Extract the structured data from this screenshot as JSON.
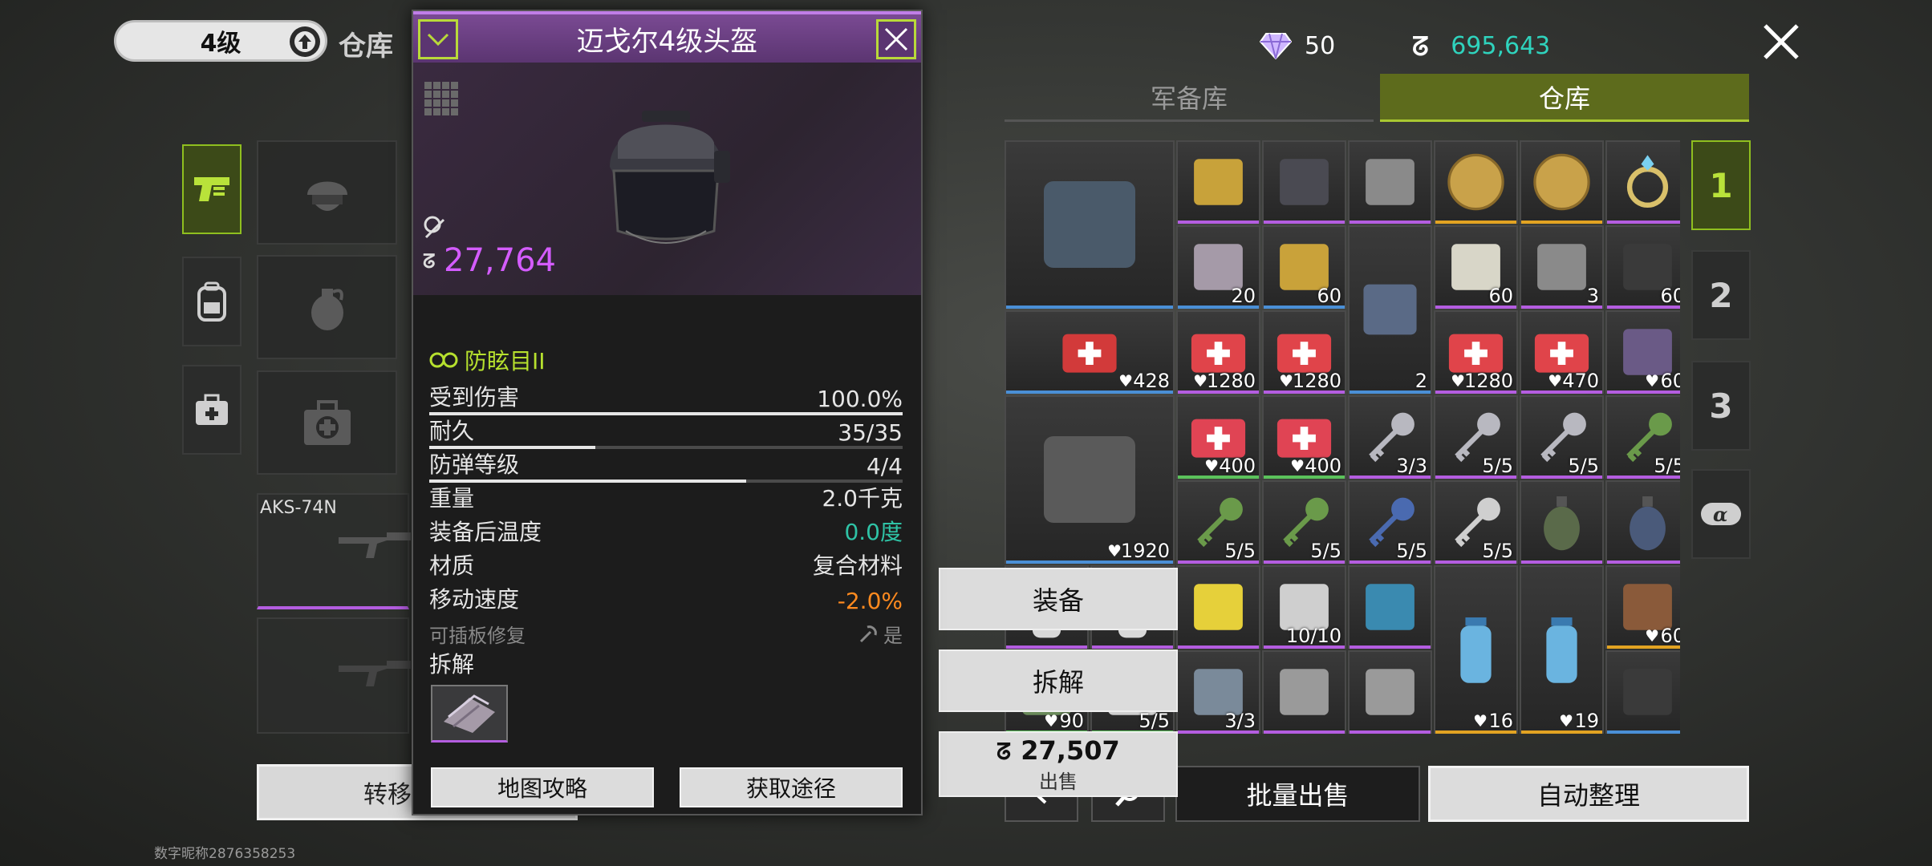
{
  "top_left": {
    "level": "4级",
    "title": "仓库"
  },
  "sidebar": {
    "tabs": [
      {
        "icon": "pistol-icon",
        "active": true
      },
      {
        "icon": "backpack-icon",
        "active": false
      },
      {
        "icon": "medkit-icon",
        "active": false
      }
    ],
    "slots": [
      {
        "icon": "helmet-icon"
      },
      {
        "icon": "grenade-icon"
      },
      {
        "icon": "first-aid-kit-icon"
      }
    ],
    "weapon_name": "AKS-74N",
    "transfer_label": "转移",
    "player_id": "数字昵称2876358253"
  },
  "detail": {
    "title": "迈戈尔4级头盔",
    "price": "27,764",
    "attr_title": "防眩目II",
    "stats": [
      {
        "label": "受到伤害",
        "value": "100.0%",
        "bar": 1.0
      },
      {
        "label": "耐久",
        "value": "35/35",
        "bar": 0.35
      },
      {
        "label": "防弹等级",
        "value": "4/4",
        "bar": 0.67
      },
      {
        "label": "重量",
        "value": "2.0千克"
      },
      {
        "label": "装备后温度",
        "value": "0.0度",
        "color": "#2fc3a6"
      },
      {
        "label": "材质",
        "value": "复合材料"
      },
      {
        "label": "移动速度",
        "value": "-2.0%",
        "color": "#ff8a1f"
      },
      {
        "label": "可插板修复",
        "value": "是",
        "dim": true
      }
    ],
    "dismantle_label": "拆解",
    "buttons": {
      "map_guide": "地图攻略",
      "get_path": "获取途径"
    }
  },
  "currency": {
    "diamonds": "50",
    "coins": "695,643"
  },
  "tabs": {
    "armory": "军备库",
    "warehouse": "仓库"
  },
  "context_menu": {
    "equip": "装备",
    "dismantle": "拆解",
    "sell_price": "27,507",
    "sell_label": "出售"
  },
  "page_tabs": [
    "1",
    "2",
    "3"
  ],
  "bottom": {
    "batch_sell": "批量出售",
    "auto_sort": "自动整理"
  },
  "grid_items": [
    {
      "name": "supply-crate",
      "col": 0,
      "row": 0,
      "w": 2,
      "h": 2,
      "count": "",
      "quality": "blue"
    },
    {
      "name": "rangefinder",
      "col": 2,
      "row": 0,
      "w": 1,
      "h": 1,
      "count": "",
      "quality": "purple"
    },
    {
      "name": "camera",
      "col": 3,
      "row": 0,
      "w": 1,
      "h": 1,
      "count": "",
      "quality": "purple"
    },
    {
      "name": "usb-drive",
      "col": 4,
      "row": 0,
      "w": 1,
      "h": 1,
      "count": "",
      "quality": "purple"
    },
    {
      "name": "gold-coin",
      "col": 5,
      "row": 0,
      "w": 1,
      "h": 1,
      "count": "",
      "quality": "gold"
    },
    {
      "name": "gold-coin",
      "col": 6,
      "row": 0,
      "w": 1,
      "h": 1,
      "count": "",
      "quality": "gold"
    },
    {
      "name": "ring",
      "col": 7,
      "row": 0,
      "w": 1,
      "h": 1,
      "count": "",
      "quality": "purple"
    },
    {
      "name": "metal-plates",
      "col": 2,
      "row": 1,
      "w": 1,
      "h": 1,
      "count": "20",
      "quality": "blue"
    },
    {
      "name": "parts",
      "col": 3,
      "row": 1,
      "w": 1,
      "h": 1,
      "count": "60",
      "quality": "blue"
    },
    {
      "name": "dog-food",
      "col": 4,
      "row": 1,
      "w": 1,
      "h": 2,
      "count": "2",
      "quality": "blue"
    },
    {
      "name": "map-paper",
      "col": 5,
      "row": 1,
      "w": 1,
      "h": 1,
      "count": "60",
      "quality": "purple"
    },
    {
      "name": "steel-bars",
      "col": 6,
      "row": 1,
      "w": 1,
      "h": 1,
      "count": "3",
      "quality": "purple"
    },
    {
      "name": "circuit-board",
      "col": 7,
      "row": 1,
      "w": 1,
      "h": 1,
      "count": "60",
      "quality": "purple"
    },
    {
      "name": "medical-bag-red",
      "col": 0,
      "row": 2,
      "w": 2,
      "h": 1,
      "count": "428",
      "quality": "blue",
      "heart": true
    },
    {
      "name": "medkit",
      "col": 2,
      "row": 2,
      "w": 1,
      "h": 1,
      "count": "1280",
      "quality": "purple",
      "heart": true
    },
    {
      "name": "medkit",
      "col": 3,
      "row": 2,
      "w": 1,
      "h": 1,
      "count": "1280",
      "quality": "purple",
      "heart": true
    },
    {
      "name": "medkit",
      "col": 5,
      "row": 2,
      "w": 1,
      "h": 1,
      "count": "1280",
      "quality": "purple",
      "heart": true
    },
    {
      "name": "medkit",
      "col": 6,
      "row": 2,
      "w": 1,
      "h": 1,
      "count": "470",
      "quality": "purple",
      "heart": true
    },
    {
      "name": "med-pouch",
      "col": 7,
      "row": 2,
      "w": 1,
      "h": 1,
      "count": "60",
      "quality": "purple",
      "heart": true
    },
    {
      "name": "tactical-medic-bag",
      "col": 0,
      "row": 3,
      "w": 2,
      "h": 2,
      "count": "1920",
      "quality": "blue",
      "heart": true
    },
    {
      "name": "bandage-pack",
      "col": 2,
      "row": 3,
      "w": 1,
      "h": 1,
      "count": "400",
      "quality": "green",
      "heart": true
    },
    {
      "name": "bandage-pack",
      "col": 3,
      "row": 3,
      "w": 1,
      "h": 1,
      "count": "400",
      "quality": "green",
      "heart": true
    },
    {
      "name": "key",
      "col": 4,
      "row": 3,
      "w": 1,
      "h": 1,
      "count": "3/3",
      "quality": "purple"
    },
    {
      "name": "key",
      "col": 5,
      "row": 3,
      "w": 1,
      "h": 1,
      "count": "5/5",
      "quality": "purple"
    },
    {
      "name": "key",
      "col": 6,
      "row": 3,
      "w": 1,
      "h": 1,
      "count": "5/5",
      "quality": "purple"
    },
    {
      "name": "key-green",
      "col": 7,
      "row": 3,
      "w": 1,
      "h": 1,
      "count": "5/5",
      "quality": "purple"
    },
    {
      "name": "key-green",
      "col": 2,
      "row": 4,
      "w": 1,
      "h": 1,
      "count": "5/5",
      "quality": "purple"
    },
    {
      "name": "key-green",
      "col": 3,
      "row": 4,
      "w": 1,
      "h": 1,
      "count": "5/5",
      "quality": "purple"
    },
    {
      "name": "key-blue",
      "col": 4,
      "row": 4,
      "w": 1,
      "h": 1,
      "count": "5/5",
      "quality": "purple"
    },
    {
      "name": "key-tagged",
      "col": 5,
      "row": 4,
      "w": 1,
      "h": 1,
      "count": "5/5",
      "quality": "purple"
    },
    {
      "name": "frag-grenade",
      "col": 6,
      "row": 4,
      "w": 1,
      "h": 1,
      "count": "",
      "quality": "purple"
    },
    {
      "name": "smoke-grenade",
      "col": 7,
      "row": 4,
      "w": 1,
      "h": 1,
      "count": "",
      "quality": "purple"
    },
    {
      "name": "bottle",
      "col": 0,
      "row": 5,
      "w": 1,
      "h": 1,
      "count": "",
      "quality": "purple"
    },
    {
      "name": "bottle",
      "col": 1,
      "row": 5,
      "w": 1,
      "h": 1,
      "count": "",
      "quality": "purple"
    },
    {
      "name": "fuel-canister",
      "col": 2,
      "row": 5,
      "w": 1,
      "h": 1,
      "count": "",
      "quality": "purple"
    },
    {
      "name": "pill-bottle",
      "col": 3,
      "row": 5,
      "w": 1,
      "h": 1,
      "count": "10/10",
      "quality": "purple"
    },
    {
      "name": "syringe",
      "col": 4,
      "row": 5,
      "w": 1,
      "h": 1,
      "count": "",
      "quality": "purple"
    },
    {
      "name": "water-bottle",
      "col": 5,
      "row": 5,
      "w": 1,
      "h": 2,
      "count": "16",
      "quality": "gold",
      "heart": true
    },
    {
      "name": "water-bottle",
      "col": 6,
      "row": 5,
      "w": 1,
      "h": 2,
      "count": "19",
      "quality": "gold",
      "heart": true
    },
    {
      "name": "bread",
      "col": 7,
      "row": 5,
      "w": 1,
      "h": 1,
      "count": "60",
      "quality": "gold",
      "heart": true
    },
    {
      "name": "canteen",
      "col": 0,
      "row": 6,
      "w": 1,
      "h": 1,
      "count": "90",
      "quality": "green",
      "heart": true
    },
    {
      "name": "jar",
      "col": 1,
      "row": 6,
      "w": 1,
      "h": 1,
      "count": "5/5",
      "quality": "green"
    },
    {
      "name": "armor-plate",
      "col": 2,
      "row": 6,
      "w": 1,
      "h": 1,
      "count": "3/3",
      "quality": "purple"
    },
    {
      "name": "dog-tag",
      "col": 3,
      "row": 6,
      "w": 1,
      "h": 1,
      "count": "",
      "quality": "purple"
    },
    {
      "name": "dog-tag",
      "col": 4,
      "row": 6,
      "w": 1,
      "h": 1,
      "count": "",
      "quality": "purple"
    },
    {
      "name": "antenna",
      "col": 7,
      "row": 6,
      "w": 1,
      "h": 1,
      "count": "",
      "quality": "blue"
    }
  ]
}
